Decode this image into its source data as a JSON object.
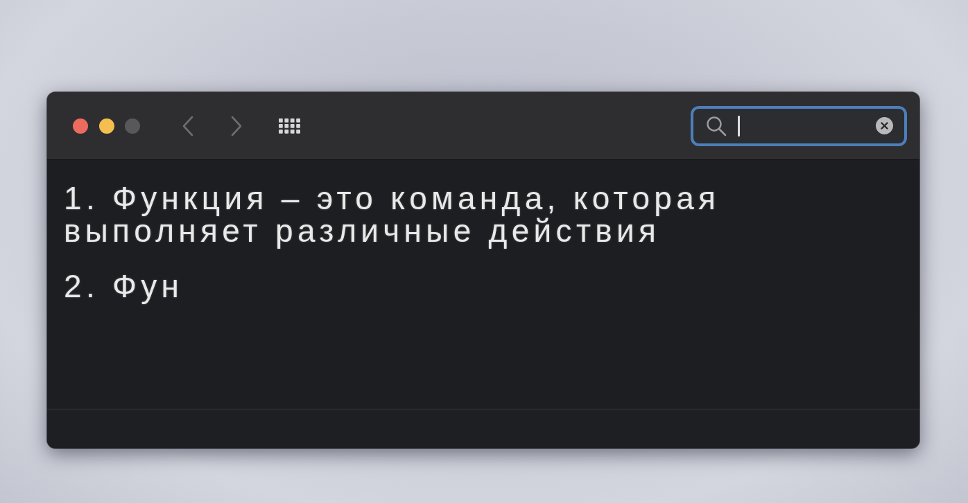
{
  "window": {
    "controls": [
      {
        "kind": "close",
        "disabled": false
      },
      {
        "kind": "minimize",
        "disabled": false
      },
      {
        "kind": "zoom",
        "disabled": true
      }
    ],
    "search": {
      "focused": true
    },
    "content": {
      "paragraphs": [
        "1. Функция – это команда, которая выполняет различные действия",
        "2. Фун"
      ]
    }
  }
}
